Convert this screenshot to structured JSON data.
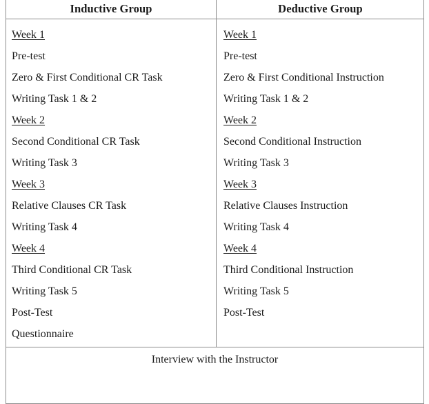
{
  "table": {
    "columns": [
      {
        "header": "Inductive Group",
        "items": [
          {
            "text": "Week 1",
            "style": "week"
          },
          {
            "text": "Pre-test",
            "style": "plain"
          },
          {
            "text": "Zero & First Conditional CR Task",
            "style": "plain"
          },
          {
            "text": "Writing Task 1 & 2",
            "style": "plain"
          },
          {
            "text": "Week 2",
            "style": "week"
          },
          {
            "text": "Second Conditional CR Task",
            "style": "plain"
          },
          {
            "text": "Writing Task 3",
            "style": "plain"
          },
          {
            "text": "Week 3",
            "style": "week"
          },
          {
            "text": "Relative Clauses CR Task",
            "style": "plain"
          },
          {
            "text": "Writing Task 4",
            "style": "plain"
          },
          {
            "text": "Week 4",
            "style": "week"
          },
          {
            "text": "Third Conditional CR Task",
            "style": "plain"
          },
          {
            "text": "Writing Task 5",
            "style": "plain"
          },
          {
            "text": "Post-Test",
            "style": "plain"
          },
          {
            "text": "Questionnaire",
            "style": "plain"
          }
        ]
      },
      {
        "header": "Deductive Group",
        "items": [
          {
            "text": "Week 1",
            "style": "week"
          },
          {
            "text": "Pre-test",
            "style": "plain"
          },
          {
            "text": "Zero & First Conditional Instruction",
            "style": "plain"
          },
          {
            "text": "Writing Task 1 & 2",
            "style": "plain"
          },
          {
            "text": "Week 2",
            "style": "week"
          },
          {
            "text": "Second Conditional Instruction",
            "style": "plain"
          },
          {
            "text": "Writing Task 3",
            "style": "plain"
          },
          {
            "text": "Week 3",
            "style": "week"
          },
          {
            "text": "Relative Clauses Instruction",
            "style": "plain"
          },
          {
            "text": "Writing Task 4",
            "style": "plain"
          },
          {
            "text": "Week 4",
            "style": "week"
          },
          {
            "text": "Third Conditional Instruction",
            "style": "plain"
          },
          {
            "text": "Writing Task 5",
            "style": "plain"
          },
          {
            "text": "Post-Test",
            "style": "plain"
          }
        ]
      }
    ],
    "footer_row": "Interview with the Instructor"
  },
  "colors": {
    "border": "#8b8b8b",
    "text": "#1a1a1a",
    "background": "#ffffff"
  }
}
